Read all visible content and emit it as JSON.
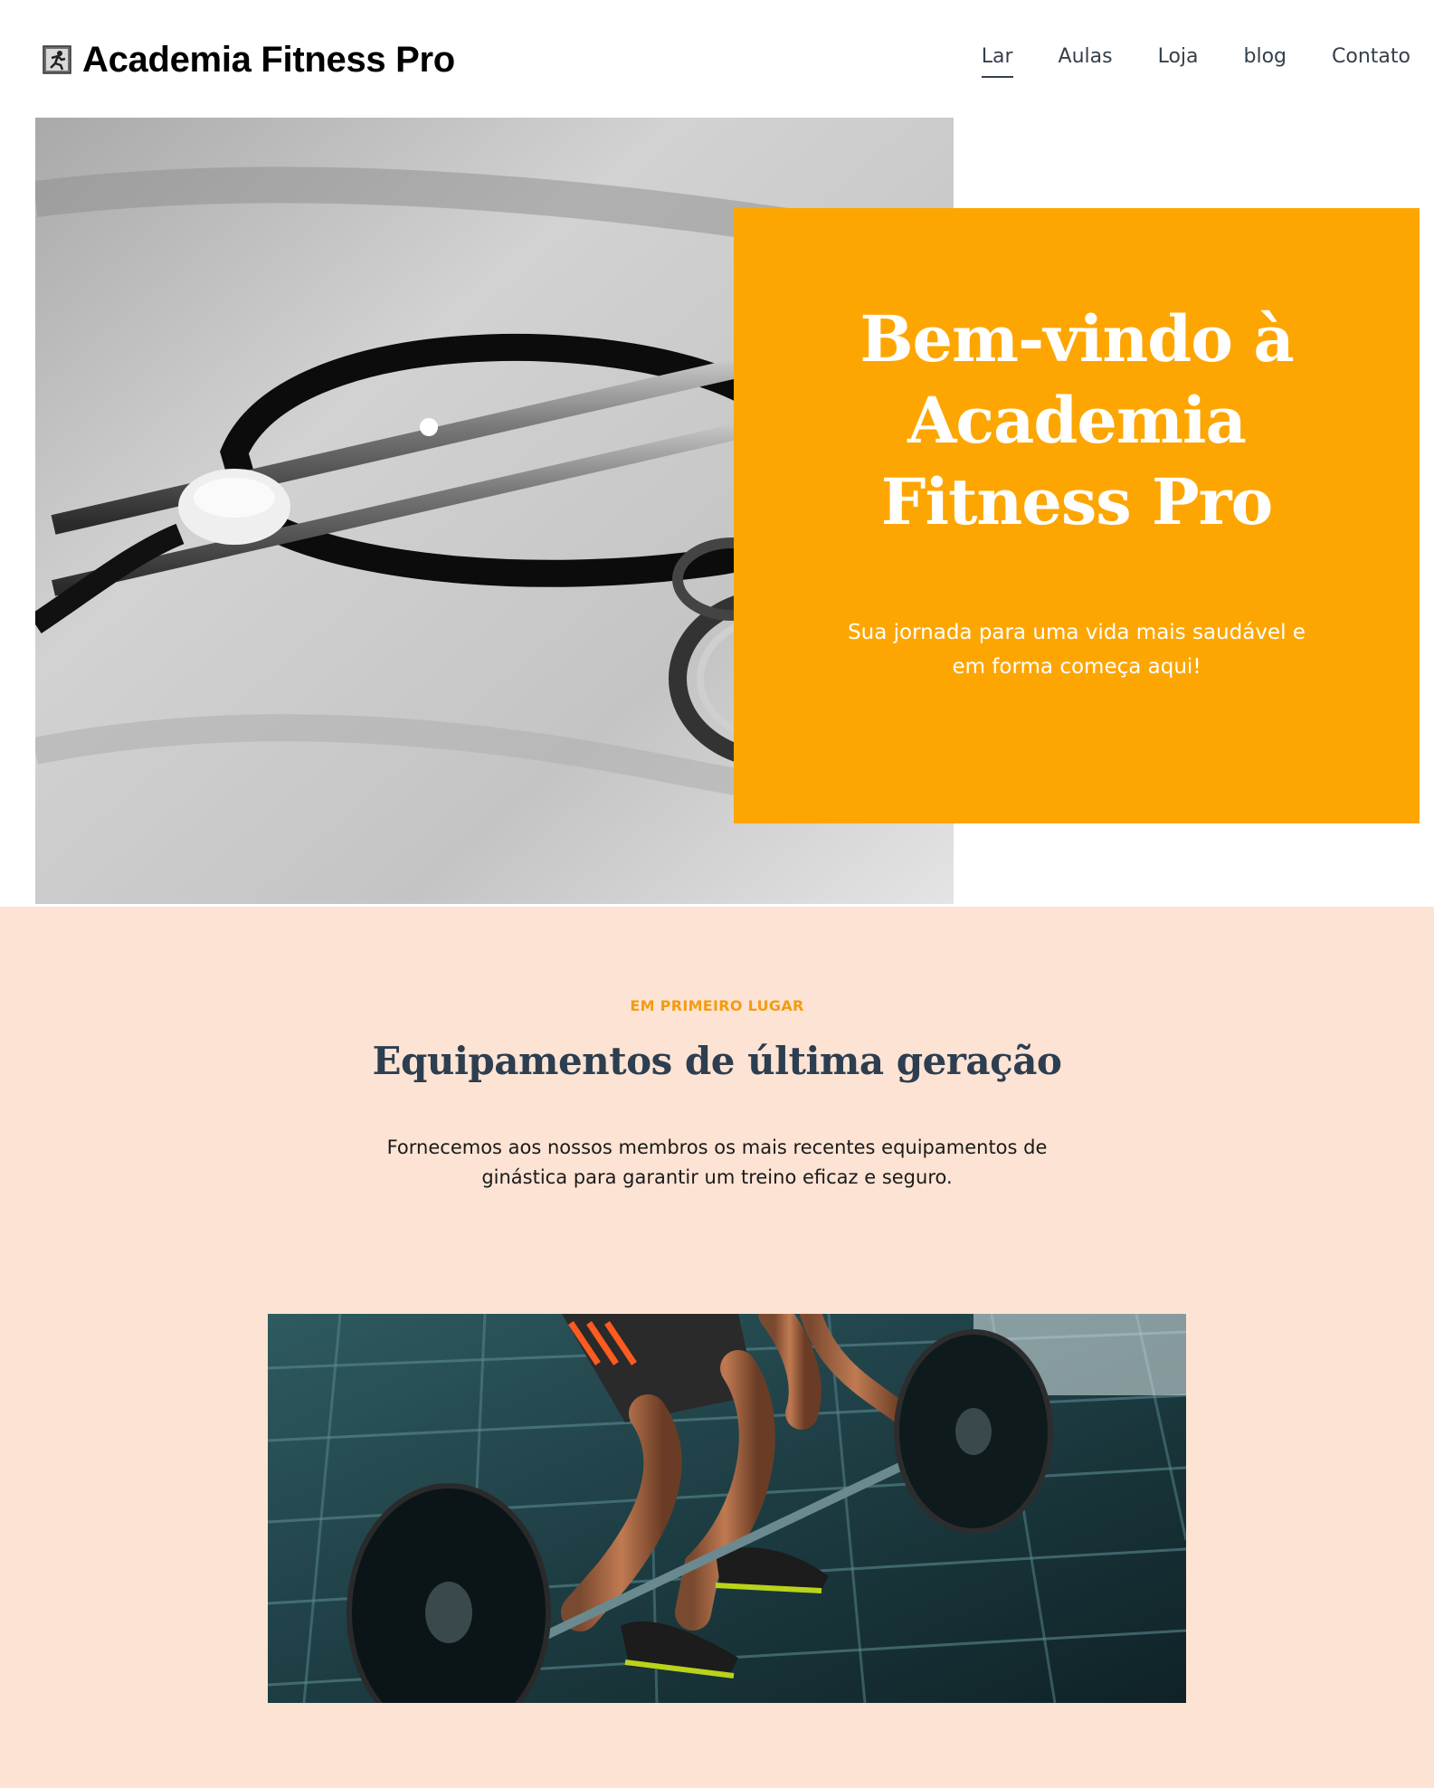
{
  "site": {
    "brand": "Academia Fitness Pro",
    "logo_icon": "runner-emoji-icon"
  },
  "nav": {
    "items": [
      {
        "label": "Lar",
        "active": true
      },
      {
        "label": "Aulas",
        "active": false
      },
      {
        "label": "Loja",
        "active": false
      },
      {
        "label": "blog",
        "active": false
      },
      {
        "label": "Contato",
        "active": false
      }
    ]
  },
  "hero": {
    "title": "Bem-vindo à Academia Fitness Pro",
    "subtitle": "Sua jornada para uma vida mais saudável e em forma começa aqui!",
    "card_color": "#fda602"
  },
  "feature": {
    "eyebrow": "EM PRIMEIRO LUGAR",
    "title": "Equipamentos de última geração",
    "text": "Fornecemos aos nossos membros os mais recentes equipamentos de ginástica para garantir um treino eficaz e seguro.",
    "background_color": "#fde3d3",
    "accent_color": "#f39c12"
  }
}
